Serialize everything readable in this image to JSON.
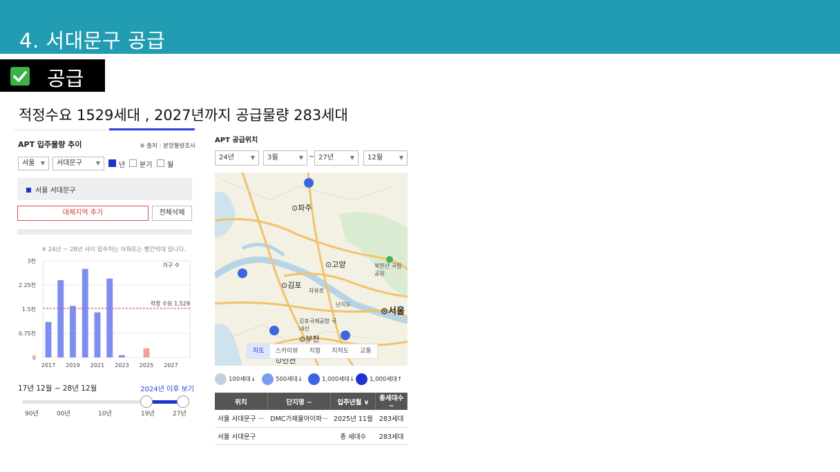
{
  "header": {
    "title": "4. 서대문구 공급"
  },
  "badge": {
    "label": "공급",
    "icon": "check-icon"
  },
  "subtitle": "적정수요 1529세대 , 2027년까지 공급물량 283세대",
  "left_panel": {
    "title": "APT 입주물량 추이",
    "source": "※ 출처 : 분양물량조사",
    "region_select": "서울",
    "district_select": "서대문구",
    "period_options": [
      {
        "label": "년",
        "checked": true
      },
      {
        "label": "분기",
        "checked": false
      },
      {
        "label": "월",
        "checked": false
      }
    ],
    "legend_item": "서울 서대문구",
    "add_region_label": "대체지역 추가",
    "clear_all_label": "전체삭제",
    "note": "※ 24년 ~ 28년 사이 입주하는 아파트는 빨간막대 입니다.",
    "period_text": "17년 12월 ~ 28년 12월",
    "after_link": "2024년 이후 보기",
    "slider_ticks": [
      "90년",
      "00년",
      "10년",
      "19년",
      "27년"
    ],
    "slider_range": {
      "from": "19년",
      "to": "27년"
    }
  },
  "chart_data": {
    "type": "bar",
    "categories": [
      "2017",
      "2018",
      "2019",
      "2020",
      "2021",
      "2022",
      "2023",
      "2024",
      "2025",
      "2026",
      "2027",
      "2028"
    ],
    "x_tick_labels": [
      "2017",
      "2019",
      "2021",
      "2023",
      "2025",
      "2027"
    ],
    "values": [
      1100,
      2400,
      1600,
      2750,
      1400,
      2450,
      70,
      0,
      283,
      0,
      0,
      0
    ],
    "highlight_from": "2024",
    "bar_color": "#7e8ef0",
    "highlight_color": "#f3a09a",
    "y_ticks": [
      0,
      750,
      1500,
      2250,
      3000
    ],
    "y_tick_labels": [
      "0",
      "0.75천",
      "1.5천",
      "2.25천",
      "3천"
    ],
    "ylim": [
      0,
      3000
    ],
    "reference_line": {
      "value": 1529,
      "label": "적정 수요 1,529",
      "color": "#e0555a"
    },
    "legend": "가구 수",
    "grid": true
  },
  "right_panel": {
    "title": "APT 공급위치",
    "from_year": "24년",
    "from_month": "3월",
    "range_sep": "~",
    "to_year": "27년",
    "to_month": "12월",
    "map_tabs": [
      "지도",
      "스카이뷰",
      "지형",
      "지적도",
      "교통"
    ],
    "active_map_tab": "지도",
    "map_labels": {
      "paju": "⊙파주",
      "goyang": "⊙고양",
      "gimpo": "⊙김포",
      "seoul": "⊙서울",
      "bucheon": "⊙부천",
      "incheon": "⊙인천",
      "bukhansan": "북한산 국립공원",
      "gimpo_airport": "김포국제공항 국내선",
      "nanjido": "난지도",
      "jayuro": "자유로"
    },
    "legend": [
      {
        "label": "100세대↓",
        "color": "#c4cfe0"
      },
      {
        "label": "500세대↓",
        "color": "#7a9df0"
      },
      {
        "label": "1,000세대↓",
        "color": "#3a66e0"
      },
      {
        "label": "1,000세대↑",
        "color": "#1d33cc"
      }
    ],
    "table": {
      "headers": [
        "위치",
        "단지명 −",
        "입주년월 ∨",
        "총세대수 −"
      ],
      "rows": [
        [
          "서울 서대문구 ···",
          "DMC가재울아이파···",
          "2025년 11월",
          "283세대"
        ],
        [
          "서울 서대문구",
          "",
          "총 세대수",
          "283세대"
        ]
      ]
    }
  }
}
